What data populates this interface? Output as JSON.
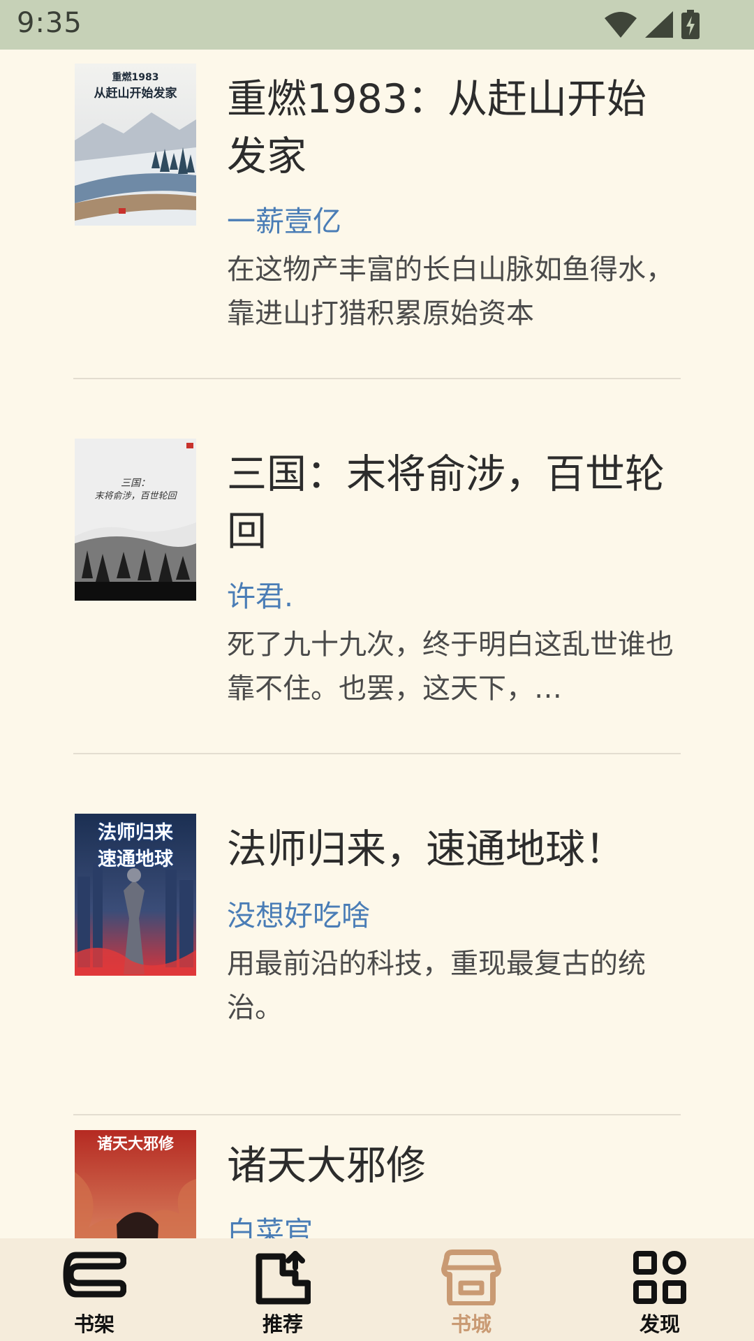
{
  "status_bar": {
    "time": "9:35"
  },
  "books": [
    {
      "title": "重燃1983：从赶山开始发家",
      "author": "一薪壹亿",
      "description": "在这物产丰富的长白山脉如鱼得水，靠进山打猎积累原始资本",
      "cover_title": "重燃1983\n从赶山开始发家"
    },
    {
      "title": "三国：末将俞涉，百世轮回",
      "author": "许君.",
      "description": "死了九十九次，终于明白这乱世谁也靠不住。也罢，这天下，…",
      "cover_title": "三国：末将俞涉，百世轮回"
    },
    {
      "title": "法师归来，速通地球！",
      "author": "没想好吃啥",
      "description": "用最前沿的科技，重现最复古的统治。",
      "cover_title": "法师归来 速通地球"
    },
    {
      "title": "诸天大邪修",
      "author": "白菜官",
      "description": "",
      "cover_title": "诸天大邪修"
    }
  ],
  "bottom_nav": {
    "items": [
      {
        "label": "书架",
        "icon": "bookshelf-icon",
        "active": false
      },
      {
        "label": "推荐",
        "icon": "recommend-icon",
        "active": false
      },
      {
        "label": "书城",
        "icon": "bookstore-icon",
        "active": true
      },
      {
        "label": "发现",
        "icon": "discover-grid-icon",
        "active": false
      }
    ]
  },
  "colors": {
    "status_bar_bg": "#c6d1b7",
    "page_bg": "#fdf8ea",
    "author_link": "#4a7db6",
    "nav_active": "#c99a73",
    "nav_bg": "#f5ecdb"
  }
}
